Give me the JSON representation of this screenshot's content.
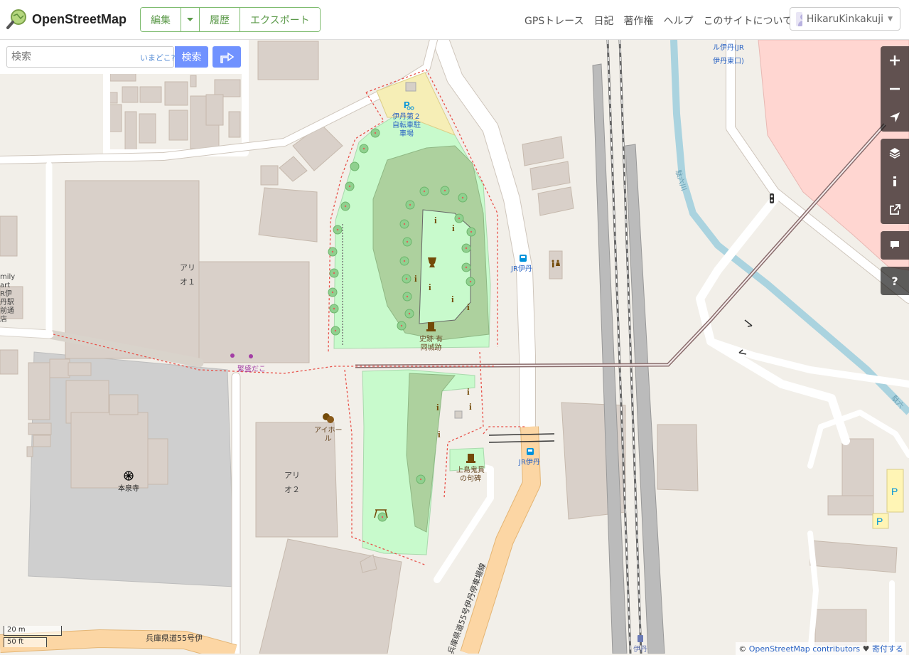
{
  "header": {
    "logo_text": "OpenStreetMap",
    "edit_label": "編集",
    "history_label": "履歴",
    "export_label": "エクスポート",
    "nav": [
      "GPSトレース",
      "日記",
      "著作権",
      "ヘルプ",
      "このサイトについて"
    ],
    "username": "HikaruKinkakuji"
  },
  "search": {
    "placeholder": "検索",
    "where_link": "いまどこ?",
    "button_label": "検索"
  },
  "map_labels": {
    "bicycle_parking": [
      "伊丹第２",
      "自転車駐",
      "車場"
    ],
    "jr_itami_bus_1": "JR伊丹",
    "jr_itami_bus_2": "JR伊丹",
    "jr_itami_east": [
      "ル伊丹(JR",
      "伊丹東口)"
    ],
    "ario1": [
      "アリ",
      "オ１"
    ],
    "ario2": [
      "アリ",
      "オ２"
    ],
    "historic_site": [
      "史跡 有",
      "岡城跡"
    ],
    "shigemori_dango": "繁盛だこ",
    "aihall": [
      "アイホー",
      "ル"
    ],
    "uejima_monument": [
      "上島鬼貫",
      "の句碑"
    ],
    "honsenji": "本泉寺",
    "left_edge_text": [
      "mily",
      "art",
      "R伊",
      "丹駅",
      "前通",
      "店"
    ],
    "road_55": "兵庫県道55号伊丹停車場線",
    "road_55_bottom": "兵庫県道55号伊",
    "river_label": "駄六川",
    "river_label_2": "駄六",
    "station_bottom": "伊丹"
  },
  "controls": {
    "zoom_in": "zoom-in",
    "zoom_out": "zoom-out",
    "locate": "locate",
    "layers": "layers",
    "info": "info",
    "share": "share",
    "note": "note",
    "help": "?"
  },
  "scale": {
    "metric": "20 m",
    "imperial": "50 ft"
  },
  "attribution": {
    "prefix": "©",
    "link": "OpenStreetMap contributors",
    "heart": "♥",
    "donate": "寄付する"
  },
  "colors": {
    "park": "#c8facc",
    "wood": "#add19e",
    "building": "#d9d0c9",
    "road_orange": "#fcd6a4",
    "railway_platform": "#bbbbbb",
    "river": "#aad3df",
    "retail": "#ffd6d1",
    "parking": "#fff5b5",
    "accent": "#7092ff",
    "edit_green": "#7ebc6f"
  }
}
